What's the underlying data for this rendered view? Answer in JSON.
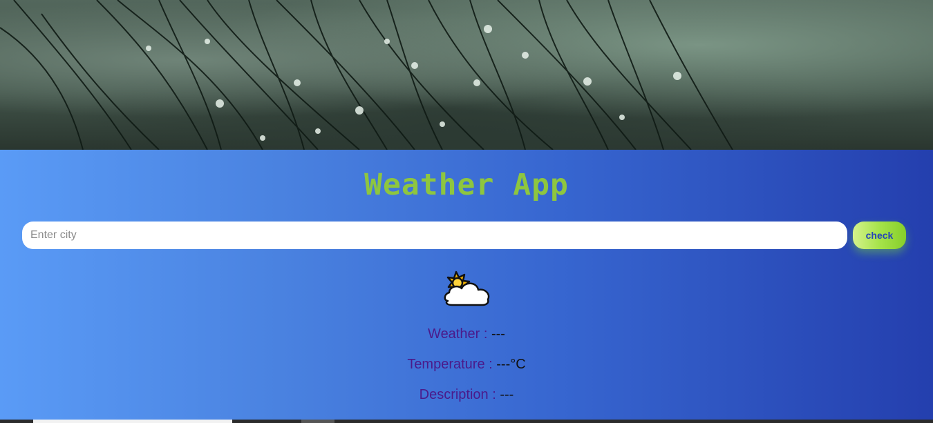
{
  "app": {
    "title": "Weather App"
  },
  "search": {
    "placeholder": "Enter city",
    "value": "",
    "button_label": "check"
  },
  "current": {
    "icon": "sun-behind-cloud-icon",
    "weather_label": "Weather : ",
    "weather_value": "---",
    "temperature_label": "Temperature : ",
    "temperature_value": "---°C",
    "description_label": "Description : ",
    "description_value": "---"
  },
  "colors": {
    "title": "#8ec63f",
    "label": "#4b1a8a",
    "button_text": "#2444b8",
    "gradient_start": "#5a9bf6",
    "gradient_end": "#243fae"
  }
}
